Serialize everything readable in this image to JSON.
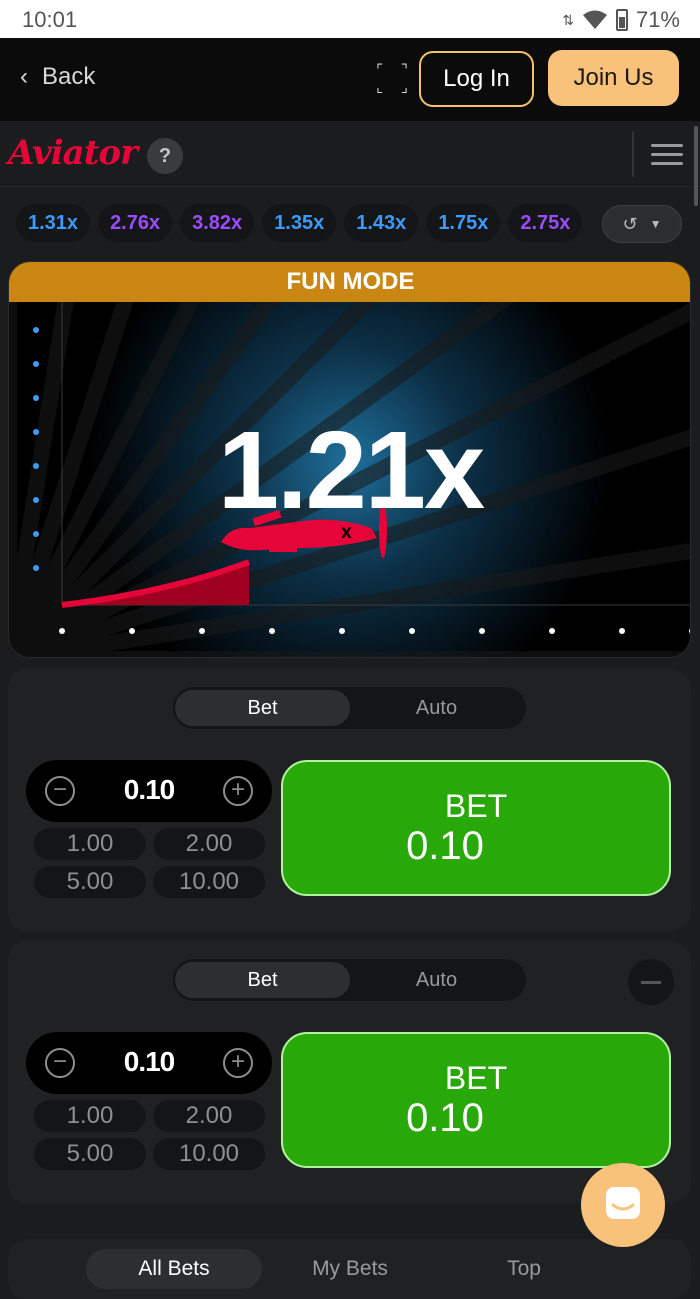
{
  "status_bar": {
    "time": "10:01",
    "battery": "71%"
  },
  "header": {
    "back_label": "Back",
    "login_label": "Log In",
    "join_label": "Join Us",
    "expand_icon": "expand-icon"
  },
  "game_bar": {
    "logo_text": "Aviator",
    "help_label": "?"
  },
  "multipliers": [
    {
      "value": "1.31x",
      "color": "#3d9bff"
    },
    {
      "value": "2.76x",
      "color": "#9b4dff"
    },
    {
      "value": "3.82x",
      "color": "#9b4dff"
    },
    {
      "value": "1.35x",
      "color": "#3d9bff"
    },
    {
      "value": "1.43x",
      "color": "#3d9bff"
    },
    {
      "value": "1.75x",
      "color": "#3d9bff"
    },
    {
      "value": "2.75x",
      "color": "#9b4dff"
    }
  ],
  "game": {
    "mode_label": "FUN MODE",
    "multiplier": "1.21x",
    "accent": "#e50539"
  },
  "bet_panels": [
    {
      "tabs": {
        "bet": "Bet",
        "auto": "Auto"
      },
      "amount": "0.10",
      "quick_amounts": [
        "1.00",
        "2.00",
        "5.00",
        "10.00"
      ],
      "button_label": "BET",
      "button_amount": "0.10"
    },
    {
      "tabs": {
        "bet": "Bet",
        "auto": "Auto"
      },
      "amount": "0.10",
      "quick_amounts": [
        "1.00",
        "2.00",
        "5.00",
        "10.00"
      ],
      "button_label": "BET",
      "button_amount": "0.10"
    }
  ],
  "bottom_tabs": {
    "all": "All Bets",
    "my": "My Bets",
    "top": "Top"
  }
}
